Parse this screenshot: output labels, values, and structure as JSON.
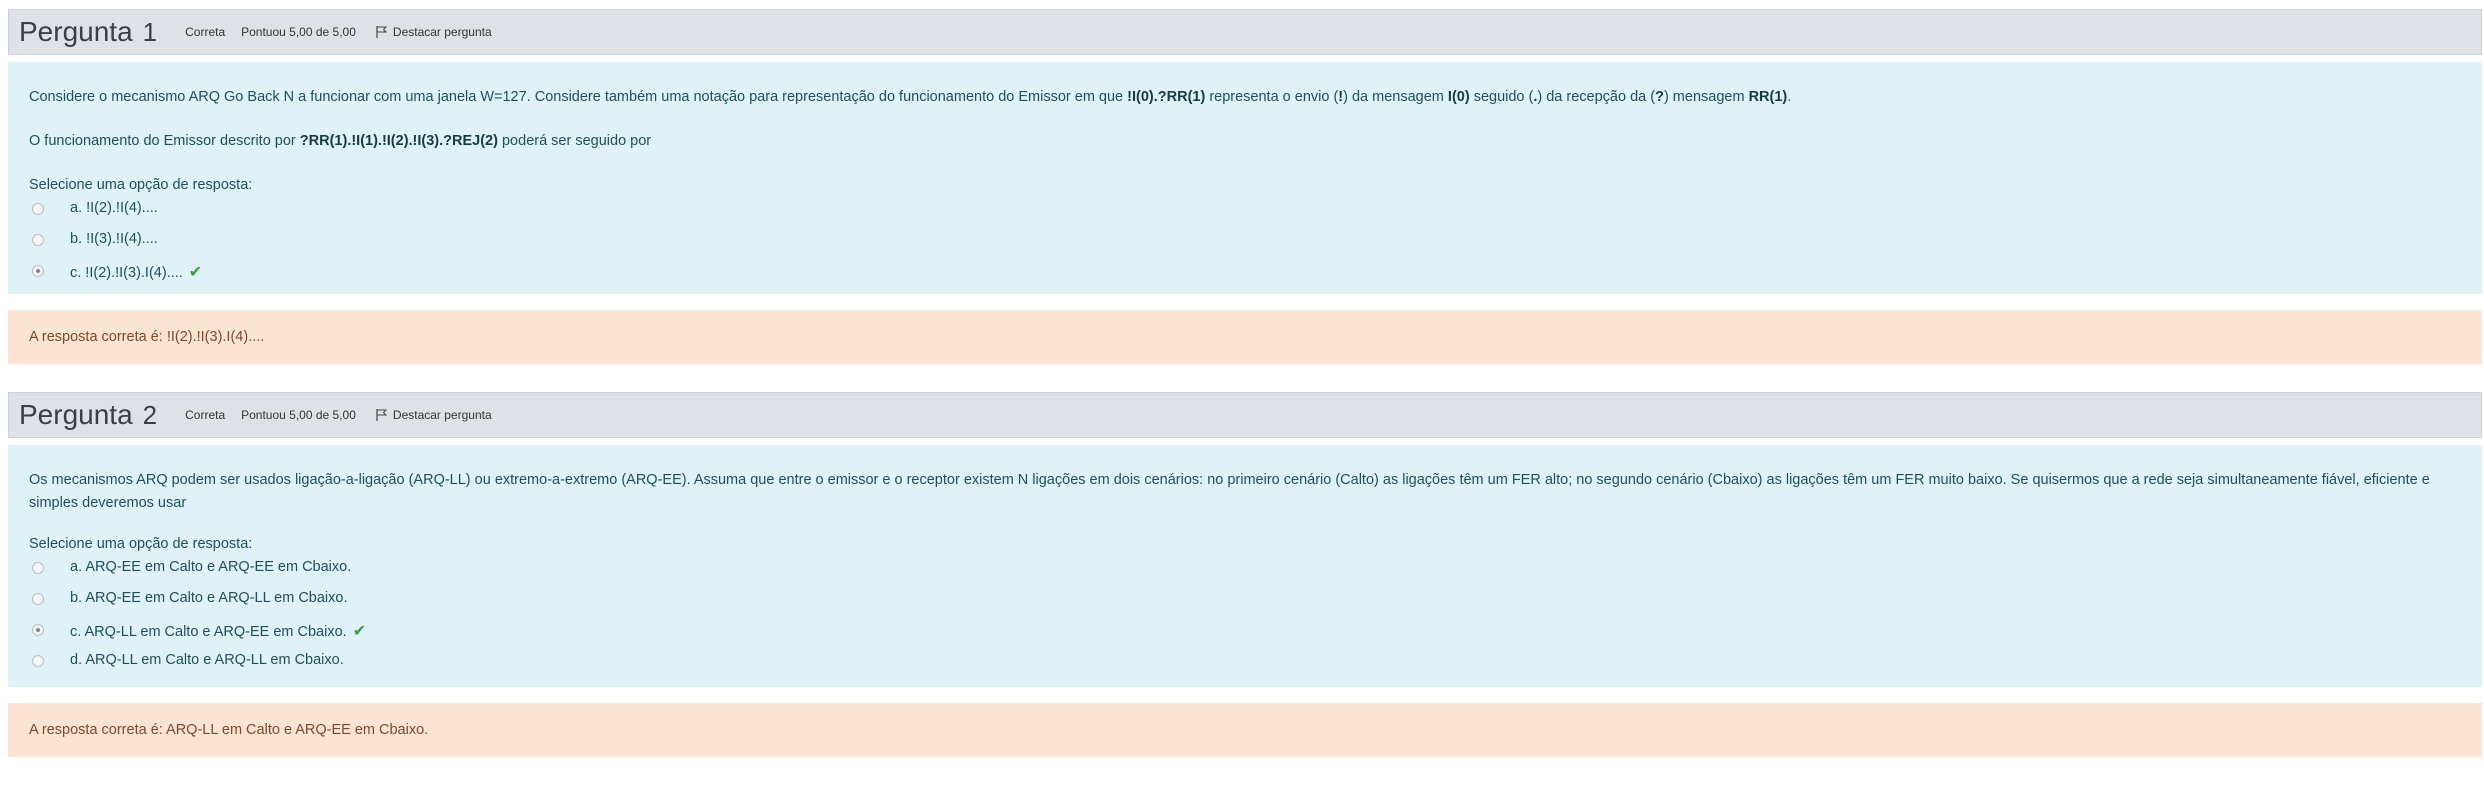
{
  "questions": [
    {
      "title_word": "Pergunta",
      "number": "1",
      "status": "Correta",
      "score": "Pontuou 5,00 de 5,00",
      "flag_label": "Destacar pergunta",
      "text_parts": {
        "p1_a": "Considere o mecanismo ARQ Go Back N a funcionar com uma janela W=127. Considere também uma notação para representação do funcionamento do Emissor em que ",
        "p1_b": "!I(0).?RR(1)",
        "p1_c": " representa o envio (",
        "p1_d": "!",
        "p1_e": ") da mensagem ",
        "p1_f": "I(0)",
        "p1_g": " seguido (",
        "p1_h": ".",
        "p1_i": ") da recepção da (",
        "p1_j": "?",
        "p1_k": ") mensagem ",
        "p1_l": "RR(1)",
        "p1_m": ".",
        "p2_a": "O funcionamento do Emissor descrito por ",
        "p2_b": "?RR(1).!I(1).!I(2).!I(3).?REJ(2)",
        "p2_c": " poderá ser seguido por"
      },
      "prompt": "Selecione uma opção de resposta:",
      "options": [
        {
          "label": "a. !I(2).!I(4)...."
        },
        {
          "label": "b. !I(3).!I(4)...."
        },
        {
          "label": "c. !I(2).!I(3).I(4)...."
        }
      ],
      "selected_option": "c",
      "check_icon": "✔",
      "feedback": "A resposta correta é: !I(2).!I(3).I(4)...."
    },
    {
      "title_word": "Pergunta",
      "number": "2",
      "status": "Correta",
      "score": "Pontuou 5,00 de 5,00",
      "flag_label": "Destacar pergunta",
      "text": "Os mecanismos ARQ podem ser usados ligação-a-ligação (ARQ-LL) ou extremo-a-extremo (ARQ-EE). Assuma que entre o emissor e o receptor existem N ligações em dois cenários: no primeiro cenário (Calto) as ligações têm um FER alto; no segundo cenário (Cbaixo) as ligações têm um FER muito baixo. Se quisermos que a rede seja simultaneamente fiável, eficiente e simples deveremos usar",
      "prompt": "Selecione uma opção de resposta:",
      "options": [
        {
          "label": "a. ARQ-EE em Calto e ARQ-EE em Cbaixo."
        },
        {
          "label": "b. ARQ-EE em Calto e ARQ-LL em Cbaixo."
        },
        {
          "label": "c. ARQ-LL em Calto e ARQ-EE em Cbaixo."
        },
        {
          "label": "d. ARQ-LL em Calto e ARQ-LL em Cbaixo."
        }
      ],
      "selected_option": "c",
      "check_icon": "✔",
      "feedback": "A resposta correta é: ARQ-LL em Calto e ARQ-EE em Cbaixo."
    }
  ],
  "colors": {
    "header_bg": "#dee2e6",
    "body_bg": "#def2f8",
    "feedback_bg": "#fce3d2",
    "check": "#3b9a3d"
  }
}
